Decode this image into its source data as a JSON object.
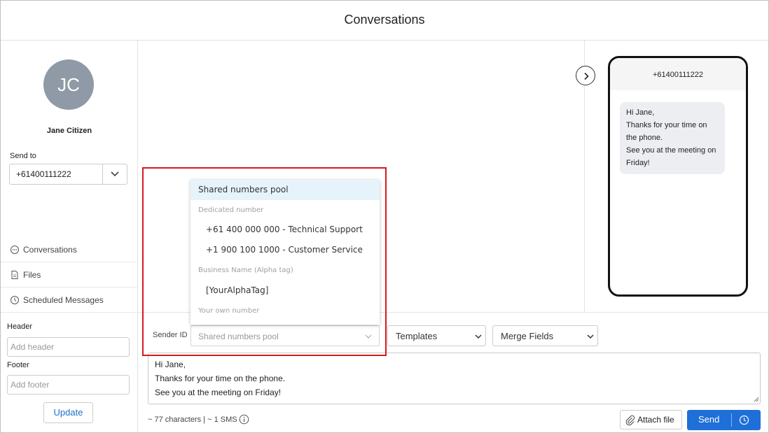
{
  "header": {
    "title": "Conversations"
  },
  "contact": {
    "initials": "JC",
    "name": "Jane Citizen",
    "avatar_color": "#8f9aa6"
  },
  "send_to": {
    "label": "Send to",
    "value": "+61400111222"
  },
  "nav": [
    {
      "label": "Conversations",
      "icon": "chat-bubble-icon"
    },
    {
      "label": "Files",
      "icon": "file-icon"
    },
    {
      "label": "Scheduled Messages",
      "icon": "clock-icon"
    }
  ],
  "header_field": {
    "label": "Header",
    "placeholder": "Add header"
  },
  "footer_field": {
    "label": "Footer",
    "placeholder": "Add footer"
  },
  "update_label": "Update",
  "preview": {
    "number": "+61400111222",
    "message_lines": [
      "Hi Jane,",
      "Thanks for your time on the phone.",
      "See you at the meeting on Friday!"
    ]
  },
  "compose": {
    "sender_label": "Sender ID",
    "sender_value": "Shared numbers pool",
    "templates_label": "Templates",
    "merge_fields_label": "Merge Fields",
    "message_lines": [
      "Hi Jane,",
      "Thanks for your time on the phone.",
      "See you at the meeting on Friday!"
    ],
    "char_count": "~ 77 characters | ~ 1 SMS",
    "attach_label": "Attach file",
    "send_label": "Send"
  },
  "sender_dropdown": {
    "selected": "Shared numbers pool",
    "groups": [
      {
        "label": "Dedicated number",
        "options": [
          "+61 400 000 000 - Technical Support",
          "+1 900 100 1000 - Customer Service"
        ]
      },
      {
        "label": "Business Name (Alpha tag)",
        "options": [
          "[YourAlphaTag]"
        ]
      },
      {
        "label": "Your own number",
        "options": []
      }
    ]
  },
  "colors": {
    "accent": "#1f6fd8",
    "highlight_border": "#d71920",
    "selected_option_bg": "#e6f3fb"
  }
}
